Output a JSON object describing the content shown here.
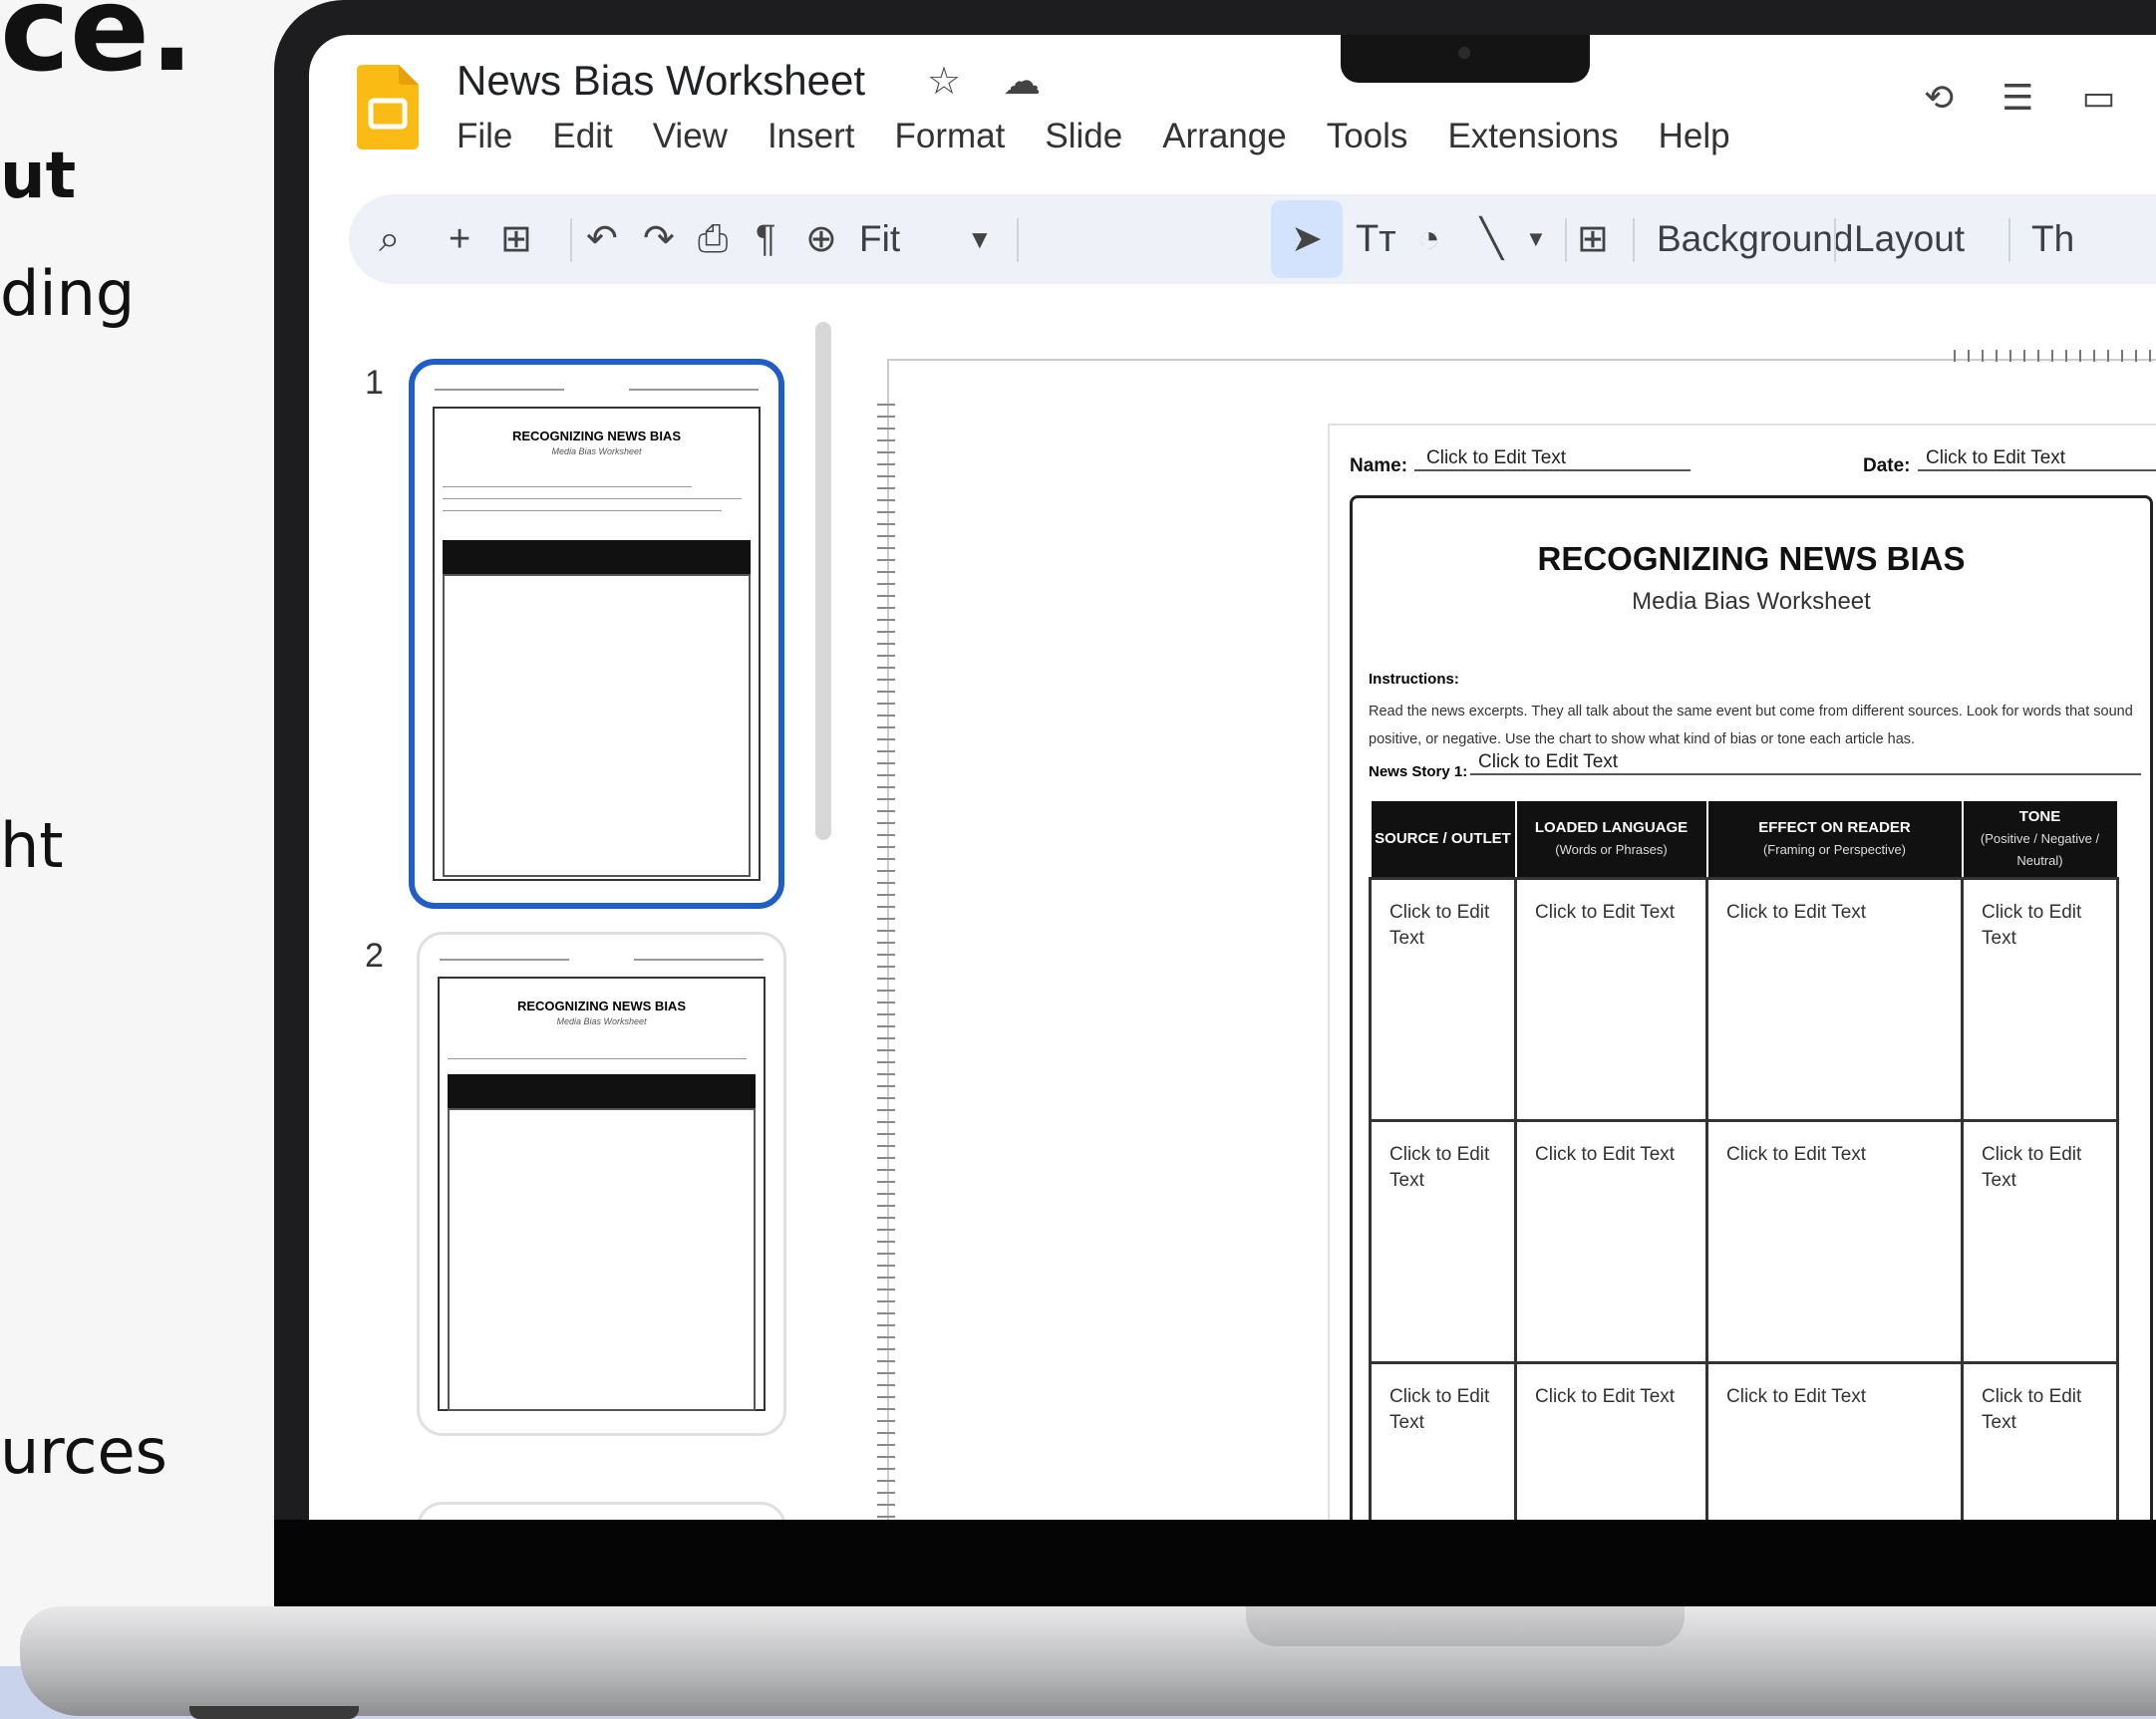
{
  "background_text": [
    "ce.",
    "ut",
    "ding",
    "ht",
    "urces"
  ],
  "app": {
    "title": "News Bias Worksheet",
    "menu": [
      "File",
      "Edit",
      "View",
      "Insert",
      "Format",
      "Slide",
      "Arrange",
      "Tools",
      "Extensions",
      "Help"
    ],
    "brand_color": "#f9bb14",
    "accent_color": "#1f5fc5"
  },
  "toolbar": {
    "zoom": "Fit",
    "background_label": "Background",
    "layout_label": "Layout",
    "theme_label_partial": "Th"
  },
  "filmstrip": {
    "slides": [
      {
        "number": "1"
      },
      {
        "number": "2"
      }
    ],
    "thumb_title": "RECOGNIZING NEWS BIAS",
    "thumb_sub": "Media Bias Worksheet"
  },
  "worksheet": {
    "name_label": "Name:",
    "name_value": "Click to Edit Text",
    "date_label": "Date:",
    "date_value": "Click to Edit Text",
    "title": "RECOGNIZING NEWS BIAS",
    "subtitle": "Media Bias Worksheet",
    "instructions_label": "Instructions:",
    "instructions": "Read the news excerpts. They all talk about the same event but come from different sources. Look for words that sound positive, or negative. Use the chart to show what kind of bias or tone each article has.",
    "story_label": "News Story 1:",
    "story_value": "Click to Edit Text",
    "columns": [
      {
        "title": "SOURCE / OUTLET",
        "sub": ""
      },
      {
        "title": "LOADED LANGUAGE",
        "sub": "(Words or Phrases)"
      },
      {
        "title": "EFFECT ON READER",
        "sub": "(Framing or Perspective)"
      },
      {
        "title": "TONE",
        "sub": "(Positive / Negative / Neutral)"
      }
    ],
    "rows": [
      [
        "Click to Edit Text",
        "Click to Edit Text",
        "Click to Edit Text",
        "Click to Edit Text"
      ],
      [
        "Click to Edit Text",
        "Click to Edit Text",
        "Click to Edit Text",
        "Click to Edit Text"
      ],
      [
        "Click to Edit Text",
        "Click to Edit Text",
        "Click to Edit Text",
        "Click to Edit Text"
      ]
    ]
  }
}
